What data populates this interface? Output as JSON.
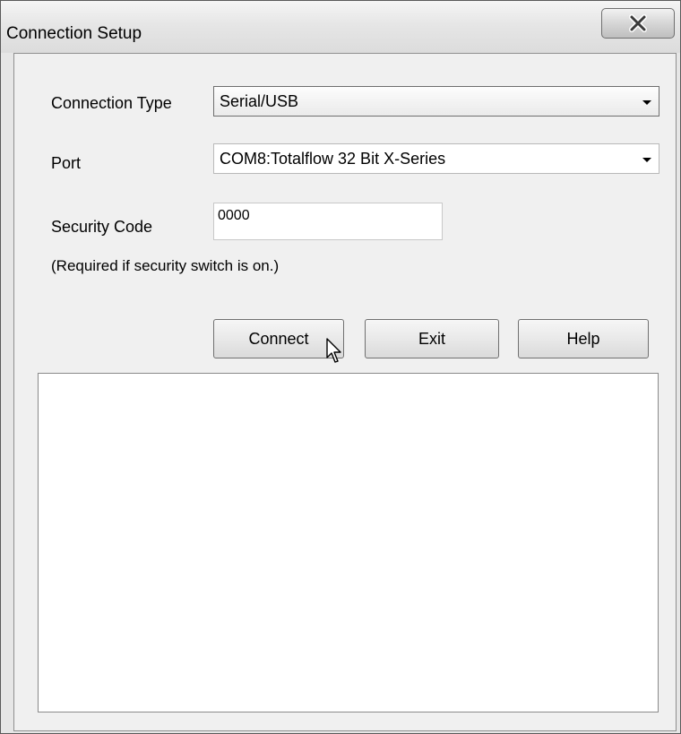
{
  "window": {
    "title": "Connection Setup",
    "close_icon": "close-x-icon"
  },
  "form": {
    "connection_type": {
      "label": "Connection Type",
      "value": "Serial/USB"
    },
    "port": {
      "label": "Port",
      "value": "COM8:Totalflow 32 Bit X-Series"
    },
    "security_code": {
      "label": "Security Code",
      "value": "0000",
      "note": "(Required if security switch is on.)"
    }
  },
  "buttons": {
    "connect": "Connect",
    "exit": "Exit",
    "help": "Help"
  },
  "output": {
    "text": ""
  },
  "colors": {
    "window_bg": "#e6e6e6",
    "client_bg": "#f0f0f0",
    "output_bg": "#ffffff"
  }
}
